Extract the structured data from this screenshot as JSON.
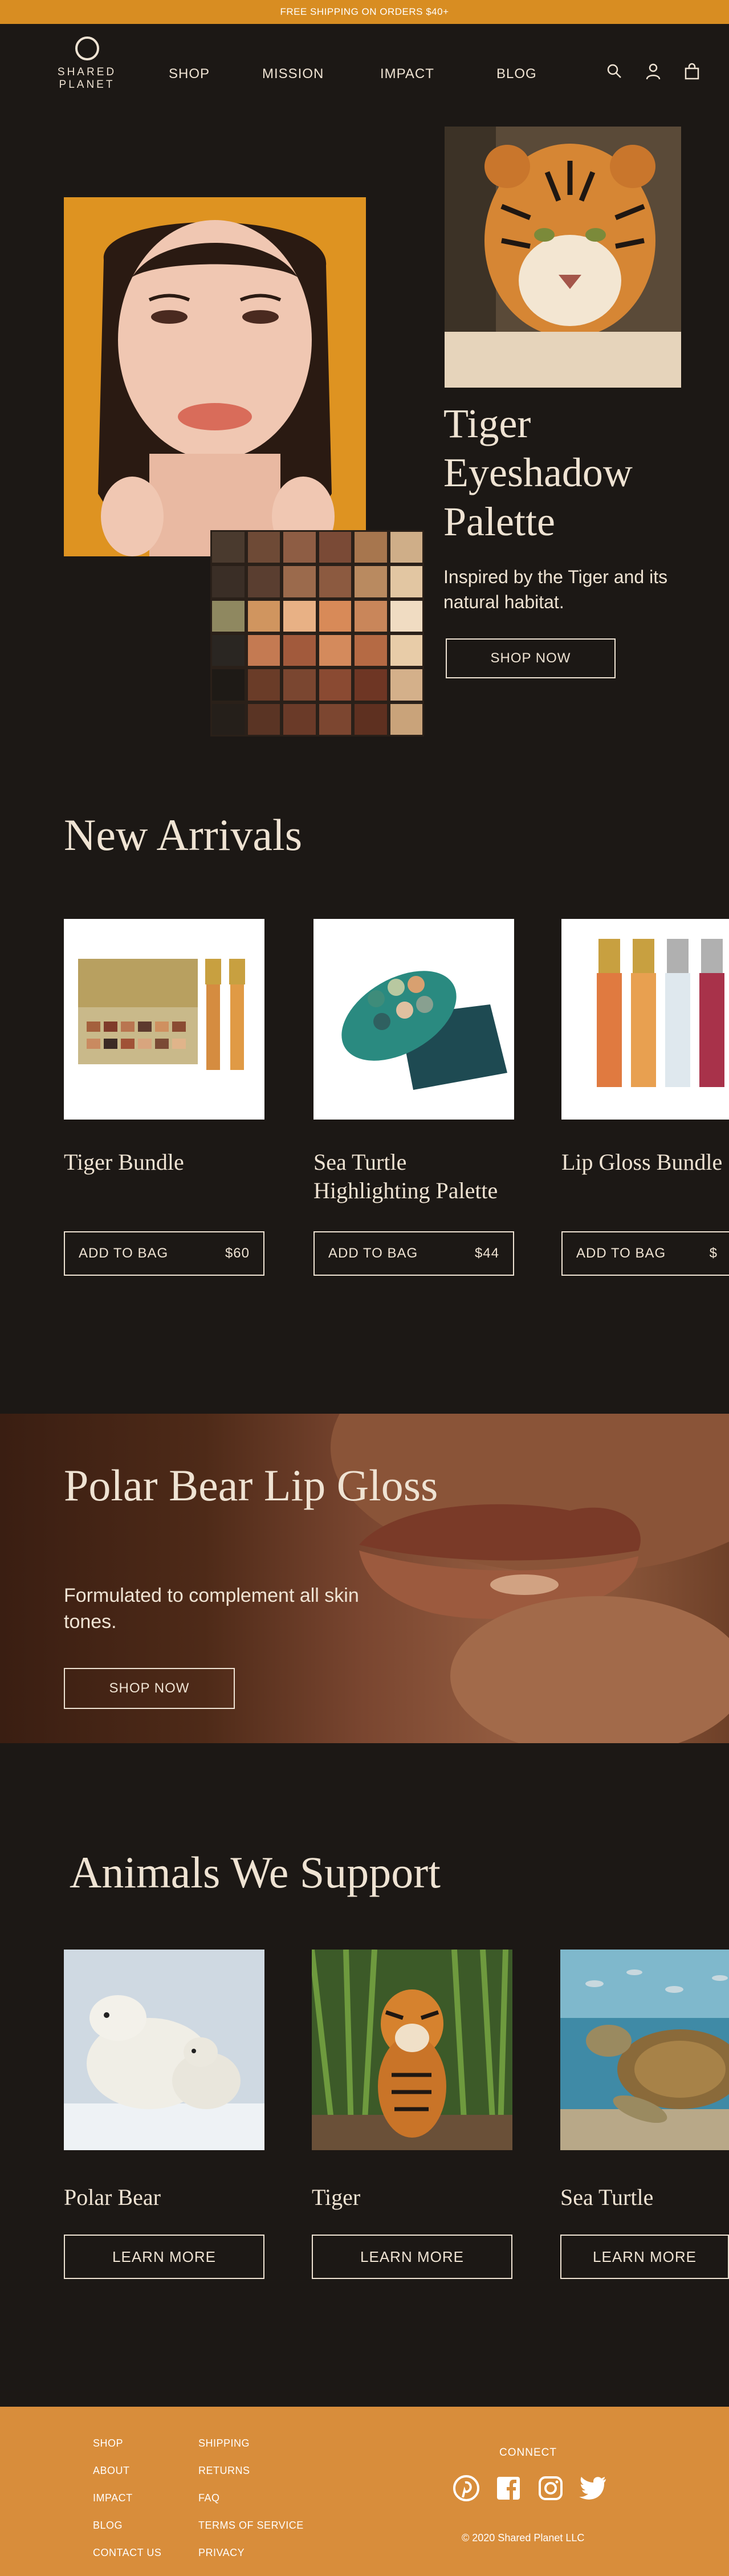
{
  "promo": {
    "text": "FREE SHIPPING ON ORDERS $40+"
  },
  "header": {
    "logo_line1": "SHARED",
    "logo_line2": "PLANET",
    "nav": [
      "SHOP",
      "MISSION",
      "IMPACT",
      "BLOG"
    ],
    "icons": [
      "search-icon",
      "user-icon",
      "bag-icon"
    ]
  },
  "hero": {
    "title": "Tiger Eyeshadow Palette",
    "subtitle": "Inspired by the Tiger and its natural habitat.",
    "button": "SHOP NOW"
  },
  "new_arrivals": {
    "title": "New Arrivals",
    "products": [
      {
        "name": "Tiger Bundle",
        "button": "ADD TO BAG",
        "price": "$60"
      },
      {
        "name": "Sea Turtle Highlighting Palette",
        "button": "ADD TO BAG",
        "price": "$44"
      },
      {
        "name": "Lip Gloss Bundle",
        "button": "ADD TO BAG",
        "price": "$"
      }
    ]
  },
  "banner": {
    "title": "Polar Bear Lip Gloss",
    "subtitle": "Formulated to complement all skin tones.",
    "button": "SHOP NOW"
  },
  "animals": {
    "title": "Animals We Support",
    "items": [
      {
        "name": "Polar Bear",
        "button": "LEARN MORE"
      },
      {
        "name": "Tiger",
        "button": "LEARN MORE"
      },
      {
        "name": "Sea Turtle",
        "button": "LEARN MORE"
      }
    ]
  },
  "footer": {
    "col1": [
      "SHOP",
      "ABOUT",
      "IMPACT",
      "BLOG",
      "CONTACT US"
    ],
    "col2": [
      "SHIPPING",
      "RETURNS",
      "FAQ",
      "TERMS OF SERVICE",
      "PRIVACY"
    ],
    "connect": "CONNECT",
    "social": [
      "pinterest-icon",
      "facebook-icon",
      "instagram-icon",
      "twitter-icon"
    ],
    "copyright": "© 2020 Shared Planet LLC"
  },
  "colors": {
    "background": "#1c1815",
    "accent": "#d88d22",
    "text": "#efe3d3",
    "footer": "#d88d3b"
  }
}
